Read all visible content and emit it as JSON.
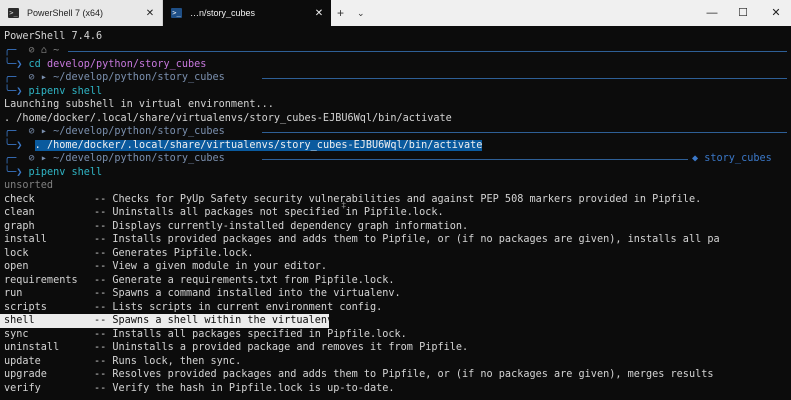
{
  "tabs": [
    {
      "icon": "powershell-icon",
      "icon_glyph": ">_",
      "label": "PowerShell 7 (x64)",
      "close": "✕"
    },
    {
      "icon": "powershell-icon",
      "icon_glyph": ">_",
      "label": "…n/story_cubes",
      "close": "✕"
    }
  ],
  "tabbar": {
    "new_tab": "+",
    "dropdown": "⌄"
  },
  "window": {
    "minimize": "—",
    "maximize": "☐",
    "close": "✕"
  },
  "terminal": {
    "version": "PowerShell 7.4.6",
    "prompt1": {
      "top": "╭─ ",
      "glyphs": " ⊘ ⌂ ~",
      "bottom": "╰─❯ ",
      "cmd_name": "cd",
      "cmd_arg": " develop/python/story_cubes"
    },
    "prompt2": {
      "top": "╭─ ",
      "glyphs": " ⊘ ▸ ~/develop/python/story_cubes",
      "bottom": "╰─❯ ",
      "cmd": "pipenv shell"
    },
    "launch_msg": "Launching subshell in virtual environment...",
    "activate_cmd": ". /home/docker/.local/share/virtualenvs/story_cubes-EJBU6Wql/bin/activate",
    "prompt3": {
      "top": "╭─ ",
      "glyphs": " ⊘ ▸ ~/develop/python/story_cubes",
      "bottom": "╰─❯  ",
      "cmd": ". /home/docker/.local/share/virtualenvs/story_cubes-EJBU6Wql/bin/activate"
    },
    "prompt4": {
      "top": "╭─ ",
      "glyphs": " ⊘ ▸ ~/develop/python/story_cubes",
      "right": "◆ story_cubes",
      "bottom": "╰─❯ ",
      "cmd": "pipenv shell"
    },
    "section_header": "unsorted",
    "completions": [
      {
        "name": "check",
        "desc": "-- Checks for PyUp Safety security vulnerabilities and against PEP 508 markers provided in Pipfile."
      },
      {
        "name": "clean",
        "desc": "-- Uninstalls all packages not specified in Pipfile.lock."
      },
      {
        "name": "graph",
        "desc": "-- Displays currently-installed dependency graph information."
      },
      {
        "name": "install",
        "desc": "-- Installs provided packages and adds them to Pipfile, or (if no packages are given), installs all pa"
      },
      {
        "name": "lock",
        "desc": "-- Generates Pipfile.lock."
      },
      {
        "name": "open",
        "desc": "-- View a given module in your editor."
      },
      {
        "name": "requirements",
        "desc": "-- Generate a requirements.txt from Pipfile.lock."
      },
      {
        "name": "run",
        "desc": "-- Spawns a command installed into the virtualenv."
      },
      {
        "name": "scripts",
        "desc": "-- Lists scripts in current environment config."
      },
      {
        "name": "shell",
        "desc": "-- Spawns a shell within the virtualenv."
      },
      {
        "name": "sync",
        "desc": "-- Installs all packages specified in Pipfile.lock."
      },
      {
        "name": "uninstall",
        "desc": "-- Uninstalls a provided package and removes it from Pipfile."
      },
      {
        "name": "update",
        "desc": "-- Runs lock, then sync."
      },
      {
        "name": "upgrade",
        "desc": "-- Resolves provided packages and adds them to Pipfile, or (if no packages are given), merges results"
      },
      {
        "name": "verify",
        "desc": "-- Verify the hash in Pipfile.lock is up-to-date."
      }
    ],
    "selected_completion": "shell",
    "cursor_glyph": "‡"
  },
  "colors": {
    "background": "#0c0c0c",
    "accent_blue": "#3b78c8",
    "cmd_cyan": "#2fb4c4",
    "arg_pink": "#c678dd",
    "selection": "#ececec",
    "selection_blue": "#0a5a9e"
  }
}
